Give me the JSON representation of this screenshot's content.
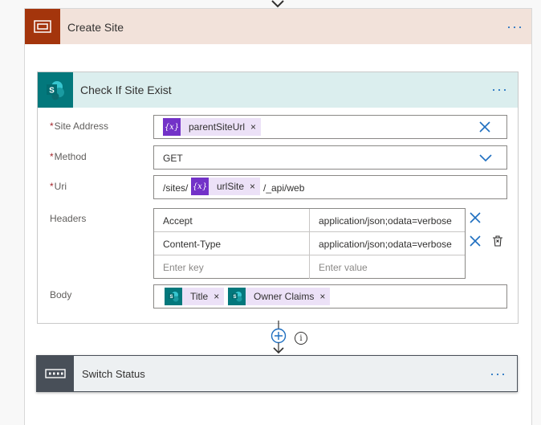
{
  "scope": {
    "title": "Create Site",
    "more_label": "···"
  },
  "action": {
    "title": "Check If Site Exist",
    "more_label": "···",
    "fields": {
      "site_address": {
        "required": "*",
        "label": "Site Address",
        "token_label": "parentSiteUrl",
        "token_icon": "{x}"
      },
      "method": {
        "required": "*",
        "label": "Method",
        "value": "GET"
      },
      "uri": {
        "required": "*",
        "label": "Uri",
        "prefix": "/sites/",
        "token_label": "urlSite",
        "token_icon": "{x}",
        "suffix": "/_api/web"
      },
      "headers": {
        "label": "Headers",
        "rows": [
          {
            "key": "Accept",
            "value": "application/json;odata=verbose"
          },
          {
            "key": "Content-Type",
            "value": "application/json;odata=verbose"
          }
        ],
        "key_placeholder": "Enter key",
        "value_placeholder": "Enter value"
      },
      "body": {
        "label": "Body",
        "tokens": [
          "Title",
          "Owner Claims"
        ]
      }
    }
  },
  "token_remove": "×",
  "info_glyph": "i",
  "switch": {
    "title": "Switch Status",
    "more_label": "···"
  },
  "colors": {
    "scope_accent": "#a4350c",
    "scope_header": "#f2e2da",
    "sharepoint": "#03787c",
    "action_header": "#dbeeee",
    "variable_token": "#7332c8",
    "variable_token_bg": "#ece1f7",
    "switch_accent": "#484f58",
    "link_blue": "#1f6fc0"
  }
}
